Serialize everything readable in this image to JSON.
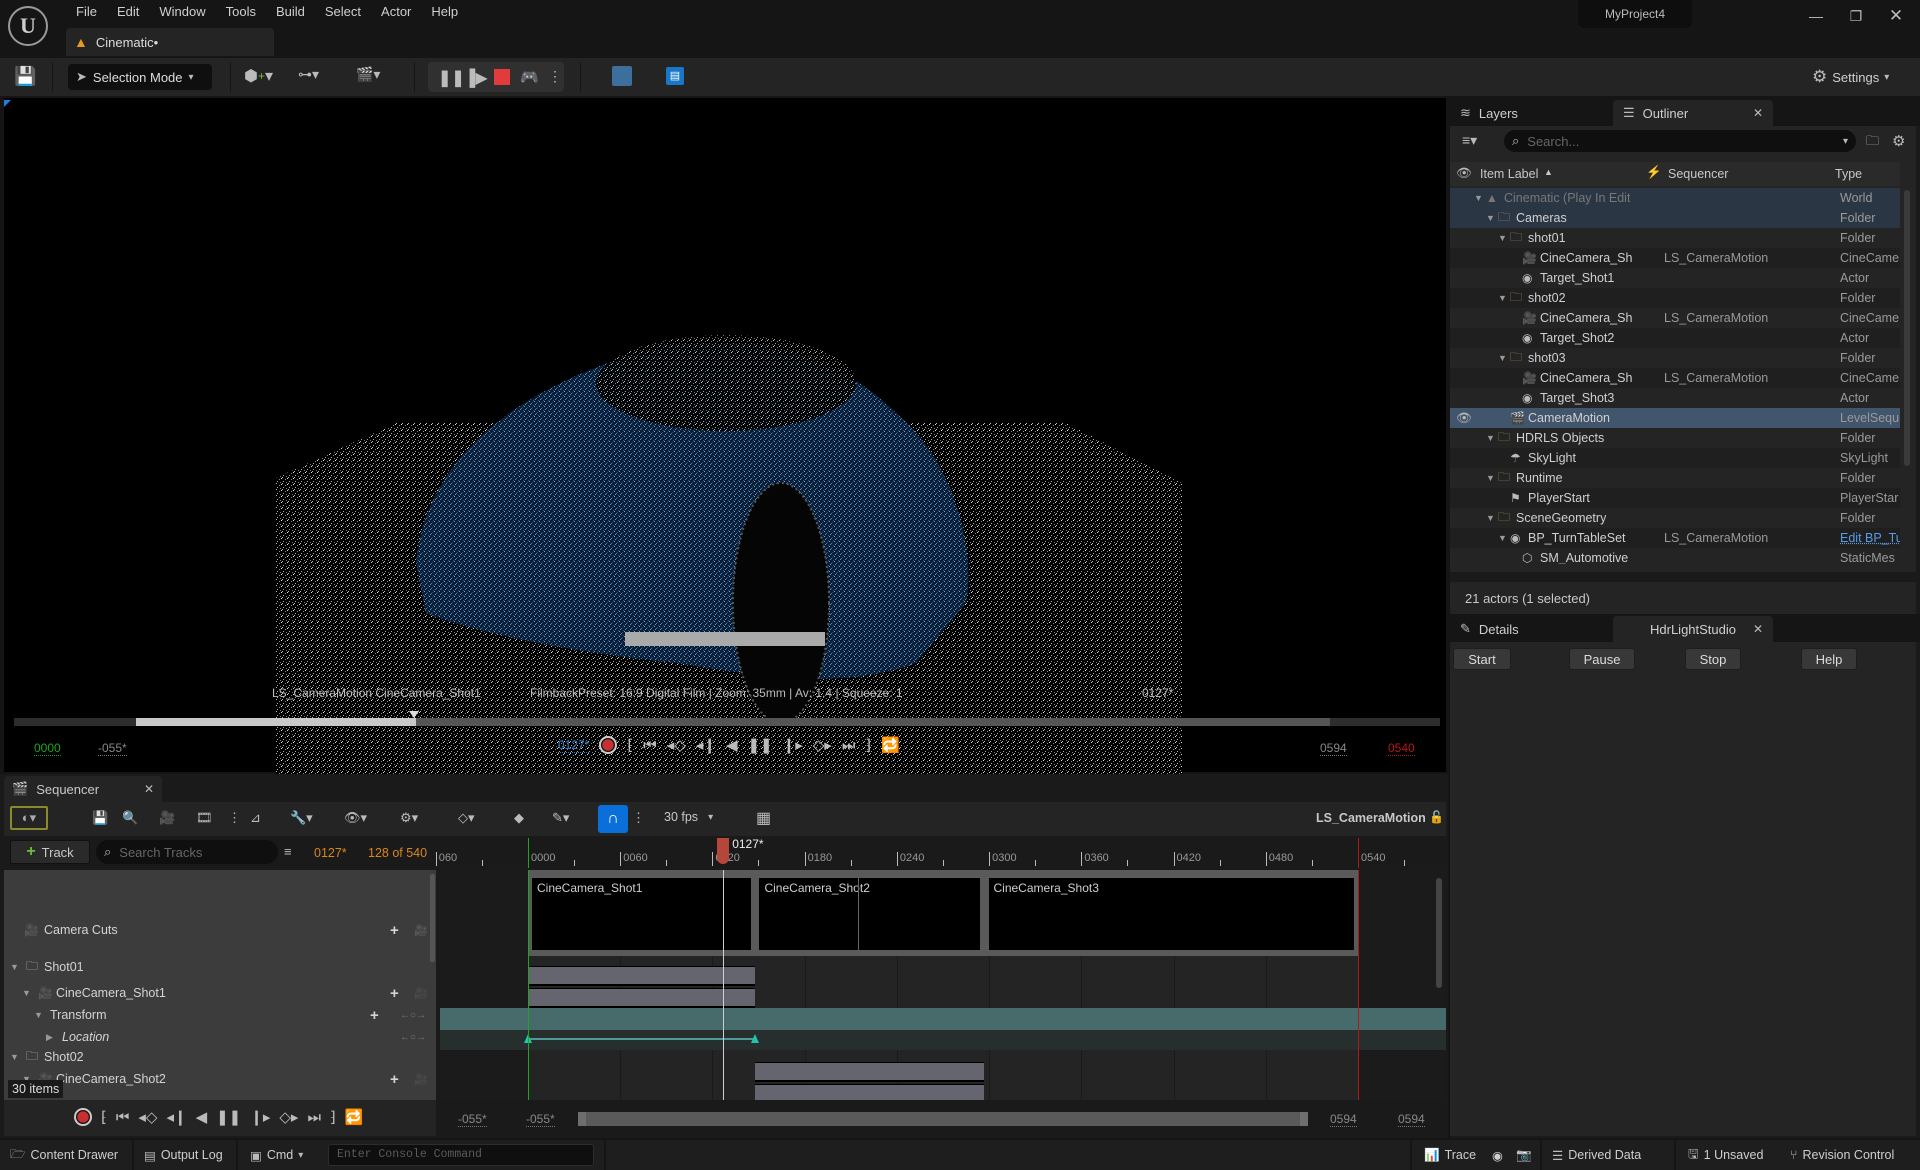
{
  "menu": {
    "items": [
      "File",
      "Edit",
      "Window",
      "Tools",
      "Build",
      "Select",
      "Actor",
      "Help"
    ],
    "document_tab": "Cinematic•",
    "project_name": "MyProject4"
  },
  "toolbar": {
    "selection_mode": "Selection Mode",
    "settings_label": "Settings"
  },
  "viewport": {
    "info_left": "LS_CameraMotion  CineCamera_Shot1",
    "info_mid": "FilmbackPreset: 16:9 Digital Film | Zoom: 35mm | Av: 1.4 | Squeeze: 1",
    "info_frame": "0127*",
    "start_frame": "0000",
    "view_start": "-055*",
    "current_frame": "0127*",
    "view_end": "0594",
    "end_frame": "0540",
    "playback_progress": 0.235
  },
  "outliner": {
    "tabs": [
      "Layers",
      "Outliner"
    ],
    "search_placeholder": "Search...",
    "columns": [
      "Item Label",
      "Sequencer",
      "Type"
    ],
    "rows": [
      {
        "label": "Cinematic (Play In Edit",
        "seq": "",
        "type": "World",
        "depth": 0,
        "kind": "world",
        "expanded": true
      },
      {
        "label": "Cameras",
        "seq": "",
        "type": "Folder",
        "depth": 1,
        "kind": "folder",
        "expanded": true
      },
      {
        "label": "shot01",
        "seq": "",
        "type": "Folder",
        "depth": 2,
        "kind": "folder",
        "expanded": true
      },
      {
        "label": "CineCamera_Sh",
        "seq": "LS_CameraMotion",
        "type": "CineCame",
        "depth": 3,
        "kind": "camera"
      },
      {
        "label": "Target_Shot1",
        "seq": "",
        "type": "Actor",
        "depth": 3,
        "kind": "actor"
      },
      {
        "label": "shot02",
        "seq": "",
        "type": "Folder",
        "depth": 2,
        "kind": "folder",
        "expanded": true
      },
      {
        "label": "CineCamera_Sh",
        "seq": "LS_CameraMotion",
        "type": "CineCame",
        "depth": 3,
        "kind": "camera"
      },
      {
        "label": "Target_Shot2",
        "seq": "",
        "type": "Actor",
        "depth": 3,
        "kind": "actor"
      },
      {
        "label": "shot03",
        "seq": "",
        "type": "Folder",
        "depth": 2,
        "kind": "folder",
        "expanded": true
      },
      {
        "label": "CineCamera_Sh",
        "seq": "LS_CameraMotion",
        "type": "CineCame",
        "depth": 3,
        "kind": "camera"
      },
      {
        "label": "Target_Shot3",
        "seq": "",
        "type": "Actor",
        "depth": 3,
        "kind": "actor"
      },
      {
        "label": "CameraMotion",
        "seq": "",
        "type": "LevelSequ",
        "depth": 2,
        "kind": "sequence",
        "selected": true
      },
      {
        "label": "HDRLS Objects",
        "seq": "",
        "type": "Folder",
        "depth": 1,
        "kind": "folder",
        "expanded": true
      },
      {
        "label": "SkyLight",
        "seq": "",
        "type": "SkyLight",
        "depth": 2,
        "kind": "skylight"
      },
      {
        "label": "Runtime",
        "seq": "",
        "type": "Folder",
        "depth": 1,
        "kind": "folder",
        "expanded": true
      },
      {
        "label": "PlayerStart",
        "seq": "",
        "type": "PlayerStar",
        "depth": 2,
        "kind": "playerstart"
      },
      {
        "label": "SceneGeometry",
        "seq": "",
        "type": "Folder",
        "depth": 1,
        "kind": "folder",
        "expanded": true
      },
      {
        "label": "BP_TurnTableSet",
        "seq": "LS_CameraMotion",
        "type": "Edit BP_Tu",
        "depth": 2,
        "kind": "actor",
        "expanded": true,
        "type_link": true
      },
      {
        "label": "SM_Automotive",
        "seq": "",
        "type": "StaticMes",
        "depth": 3,
        "kind": "mesh"
      }
    ],
    "status": "21 actors (1 selected)"
  },
  "details": {
    "tabs": [
      "Details",
      "HdrLightStudio"
    ],
    "buttons": [
      "Start",
      "Pause",
      "Stop",
      "Help"
    ]
  },
  "sequencer": {
    "tab": "Sequencer",
    "fps": "30 fps",
    "sequence_name": "LS_CameraMotion",
    "add_track": "Track",
    "search_placeholder": "Search Tracks",
    "current_frame": "0127*",
    "frame_count": "128 of 540",
    "playhead_label": "0127*",
    "ruler": [
      "060",
      "0000",
      "0060",
      "0120",
      "0180",
      "0240",
      "0300",
      "0360",
      "0420",
      "0480",
      "0540"
    ],
    "tracks": [
      {
        "label": "Camera Cuts",
        "depth": 0,
        "kind": "cuts"
      },
      {
        "label": "Shot01",
        "depth": 0,
        "kind": "folder"
      },
      {
        "label": "CineCamera_Shot1",
        "depth": 1,
        "kind": "camera"
      },
      {
        "label": "Transform",
        "depth": 2,
        "kind": "transform"
      },
      {
        "label": "Location",
        "depth": 3,
        "kind": "location"
      },
      {
        "label": "Shot02",
        "depth": 0,
        "kind": "folder"
      },
      {
        "label": "CineCamera_Shot2",
        "depth": 1,
        "kind": "camera"
      }
    ],
    "shots": [
      "CineCamera_Shot1",
      "CineCamera_Shot2",
      "CineCamera_Shot3"
    ],
    "item_count": "30 items",
    "bottom": {
      "view_start": "-055*",
      "work_start": "-055*",
      "work_end": "0594",
      "view_end": "0594"
    }
  },
  "statusbar": {
    "content_drawer": "Content Drawer",
    "output_log": "Output Log",
    "cmd": "Cmd",
    "console_placeholder": "Enter Console Command",
    "trace": "Trace",
    "derived_data": "Derived Data",
    "unsaved": "1 Unsaved",
    "revision_control": "Revision Control"
  },
  "colors": {
    "accent": "#0a6fd8",
    "record": "#e23b3b",
    "start_green": "#1fa51f",
    "end_red": "#b81616",
    "timecode_orange": "#d8861c",
    "folder": "#b08a50",
    "selected_row": "#41556c",
    "transform_track": "#466b6a"
  }
}
